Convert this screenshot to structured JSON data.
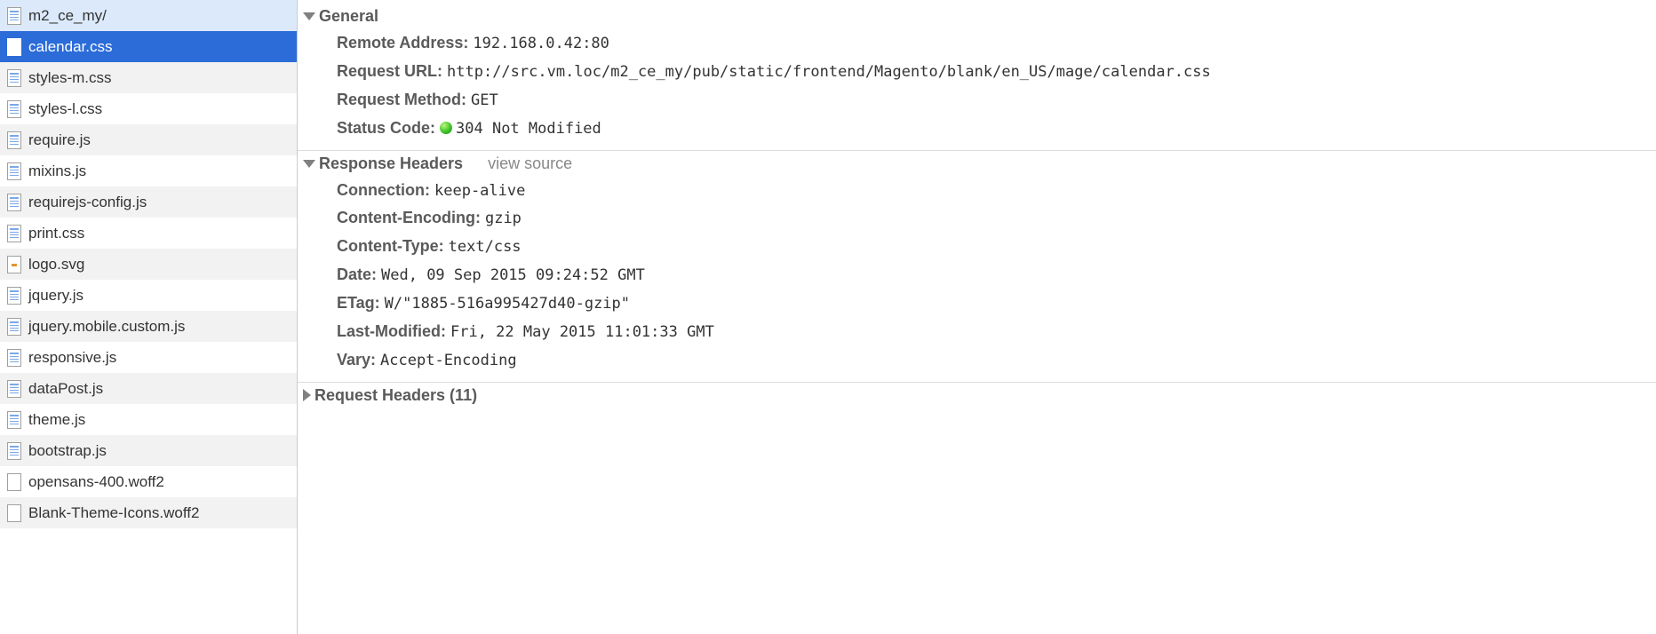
{
  "sidebar": {
    "items": [
      {
        "name": "m2_ce_my/",
        "icon": "doc",
        "highlighted": true,
        "selected": false
      },
      {
        "name": "calendar.css",
        "icon": "doc",
        "highlighted": false,
        "selected": true
      },
      {
        "name": "styles-m.css",
        "icon": "doc",
        "highlighted": false,
        "selected": false
      },
      {
        "name": "styles-l.css",
        "icon": "doc",
        "highlighted": false,
        "selected": false
      },
      {
        "name": "require.js",
        "icon": "doc",
        "highlighted": false,
        "selected": false
      },
      {
        "name": "mixins.js",
        "icon": "doc",
        "highlighted": false,
        "selected": false
      },
      {
        "name": "requirejs-config.js",
        "icon": "doc",
        "highlighted": false,
        "selected": false
      },
      {
        "name": "print.css",
        "icon": "doc",
        "highlighted": false,
        "selected": false
      },
      {
        "name": "logo.svg",
        "icon": "svg",
        "highlighted": false,
        "selected": false
      },
      {
        "name": "jquery.js",
        "icon": "doc",
        "highlighted": false,
        "selected": false
      },
      {
        "name": "jquery.mobile.custom.js",
        "icon": "doc",
        "highlighted": false,
        "selected": false
      },
      {
        "name": "responsive.js",
        "icon": "doc",
        "highlighted": false,
        "selected": false
      },
      {
        "name": "dataPost.js",
        "icon": "doc",
        "highlighted": false,
        "selected": false
      },
      {
        "name": "theme.js",
        "icon": "doc",
        "highlighted": false,
        "selected": false
      },
      {
        "name": "bootstrap.js",
        "icon": "doc",
        "highlighted": false,
        "selected": false
      },
      {
        "name": "opensans-400.woff2",
        "icon": "font",
        "highlighted": false,
        "selected": false
      },
      {
        "name": "Blank-Theme-Icons.woff2",
        "icon": "font",
        "highlighted": false,
        "selected": false
      }
    ]
  },
  "sections": {
    "general": {
      "title": "General",
      "expanded": true,
      "rows": [
        {
          "label": "Remote Address:",
          "value": "192.168.0.42:80"
        },
        {
          "label": "Request URL:",
          "value": "http://src.vm.loc/m2_ce_my/pub/static/frontend/Magento/blank/en_US/mage/calendar.css"
        },
        {
          "label": "Request Method:",
          "value": "GET"
        },
        {
          "label": "Status Code:",
          "value": "304 Not Modified",
          "status": true
        }
      ]
    },
    "response": {
      "title": "Response Headers",
      "expanded": true,
      "view_source": "view source",
      "rows": [
        {
          "label": "Connection:",
          "value": "keep-alive"
        },
        {
          "label": "Content-Encoding:",
          "value": "gzip"
        },
        {
          "label": "Content-Type:",
          "value": "text/css"
        },
        {
          "label": "Date:",
          "value": "Wed, 09 Sep 2015 09:24:52 GMT"
        },
        {
          "label": "ETag:",
          "value": "W/\"1885-516a995427d40-gzip\""
        },
        {
          "label": "Last-Modified:",
          "value": "Fri, 22 May 2015 11:01:33 GMT"
        },
        {
          "label": "Vary:",
          "value": "Accept-Encoding"
        }
      ]
    },
    "request": {
      "title": "Request Headers (11)",
      "expanded": false
    }
  }
}
